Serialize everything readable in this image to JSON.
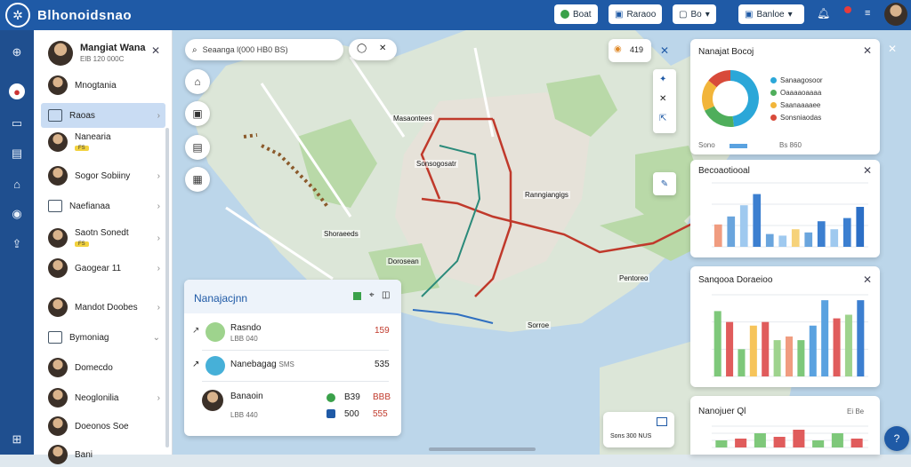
{
  "app": {
    "title": "Blhonoidsnao"
  },
  "topbar": {
    "btn1": "Boat",
    "btn2": "Raraoo",
    "btn3": "Bo",
    "btn4": "Banloe",
    "icon_logo": "compass-icon",
    "icon_bell": "bell-icon"
  },
  "sidebar": {
    "profile_name": "Mangiat Wana",
    "profile_sub": "ElB 120 000C",
    "items": [
      {
        "label": "Mnogtania"
      },
      {
        "label": "Raoas"
      },
      {
        "label": "Nanearia",
        "badge": "FS"
      },
      {
        "label": "Sogor Sobiiny"
      },
      {
        "label": "Naefianaa"
      },
      {
        "label": "Saotn Sonedt",
        "badge": "FS"
      },
      {
        "label": "Gaogear 11"
      },
      {
        "label": "Mandot Doobes"
      },
      {
        "label": "Bymoniag"
      },
      {
        "label": "Domecdo"
      },
      {
        "label": "Neoglonilia"
      },
      {
        "label": "Doeonos Soe"
      },
      {
        "label": "Bani"
      }
    ]
  },
  "map": {
    "search_placeholder": "Seaanga l(000 HB0 BS)",
    "poi_count": "419",
    "labels": [
      "Masaontees",
      "Sonsogosatr",
      "Shoraeeds",
      "Ranngiangigs",
      "Dorosean",
      "Pentoreo",
      "Sorroe"
    ]
  },
  "navpanel": {
    "title": "Nanajacjnn",
    "rows": [
      {
        "label": "Rasndo",
        "sub": "LBB 040",
        "value": "159"
      },
      {
        "label": "Nanebagag",
        "sub": "SMS",
        "value": "535"
      },
      {
        "label": "Banaoin",
        "sub": "LBB 440",
        "value1": "B39",
        "value2": "BBB",
        "value3": "500",
        "value4": "555"
      }
    ]
  },
  "popup": {
    "label": "Sons 300 NUS"
  },
  "donut_card": {
    "title": "Nanajat Bocoj",
    "legend": [
      {
        "label": "Sanaagosoor",
        "color": "#2ba7d8"
      },
      {
        "label": "Oaaaaoaaaa",
        "color": "#4fae5b"
      },
      {
        "label": "Saanaaaaee",
        "color": "#f2b53a"
      },
      {
        "label": "Sonsniaodas",
        "color": "#d84a3a"
      }
    ],
    "footer_left": "Sono",
    "footer_right": "Bs 860"
  },
  "bar_card1": {
    "title": "Becoaotiooal"
  },
  "bar_card2": {
    "title": "Sanqooa Doraeioo"
  },
  "bar_card3": {
    "title": "Nanojuer Ql",
    "right": "Ei  Be"
  },
  "chart_data": [
    {
      "type": "bar",
      "title": "Becoaotiooal",
      "categories": [
        "",
        "",
        "",
        "",
        "",
        "",
        "",
        "",
        "",
        "",
        "",
        ""
      ],
      "series": [
        {
          "values": [
            14,
            19,
            26,
            33,
            8,
            7,
            11,
            9,
            16,
            11,
            18,
            25
          ]
        }
      ],
      "colors": [
        "#f09c80",
        "#6aa5dd",
        "#9fc9ef",
        "#3c7fd0",
        "#6aa5dd",
        "#9fc9ef",
        "#f6d27a",
        "#6aa5dd",
        "#3c7fd0",
        "#9fc9ef",
        "#3c7fd0",
        "#2c6fc6"
      ],
      "ylim": [
        0,
        40
      ]
    },
    {
      "type": "bar",
      "title": "Sanqooa Doraeioo",
      "categories": [
        "",
        "",
        "",
        "",
        "",
        "",
        "",
        "",
        "",
        "",
        "",
        "",
        ""
      ],
      "series": [
        {
          "values": [
            36,
            30,
            15,
            28,
            30,
            20,
            22,
            20,
            28,
            42,
            32,
            34,
            42
          ]
        }
      ],
      "colors": [
        "#7ec87a",
        "#e05c5c",
        "#7ec87a",
        "#f6c45a",
        "#e05c5c",
        "#9ed38d",
        "#f09c80",
        "#7ec87a",
        "#5aa2e0",
        "#5aa2e0",
        "#e05c5c",
        "#9ed38d",
        "#3c7fd0"
      ],
      "ylim": [
        0,
        45
      ]
    },
    {
      "type": "bar",
      "title": "Nanojuer Ql",
      "categories": [
        "",
        "",
        "",
        "",
        "",
        "",
        "",
        ""
      ],
      "series": [
        {
          "values": [
            8,
            10,
            16,
            12,
            20,
            8,
            16,
            10
          ]
        }
      ],
      "colors": [
        "#7ec87a",
        "#e05c5c",
        "#7ec87a",
        "#e05c5c",
        "#e05c5c",
        "#7ec87a",
        "#7ec87a",
        "#e05c5c"
      ],
      "ylim": [
        0,
        24
      ]
    },
    {
      "type": "pie",
      "title": "Nanajat Bocoj",
      "categories": [
        "Sanaagosoor",
        "Oaaaaoaaaa",
        "Saanaaaaee",
        "Sonsniaodas"
      ],
      "values": [
        48,
        20,
        18,
        14
      ]
    }
  ]
}
